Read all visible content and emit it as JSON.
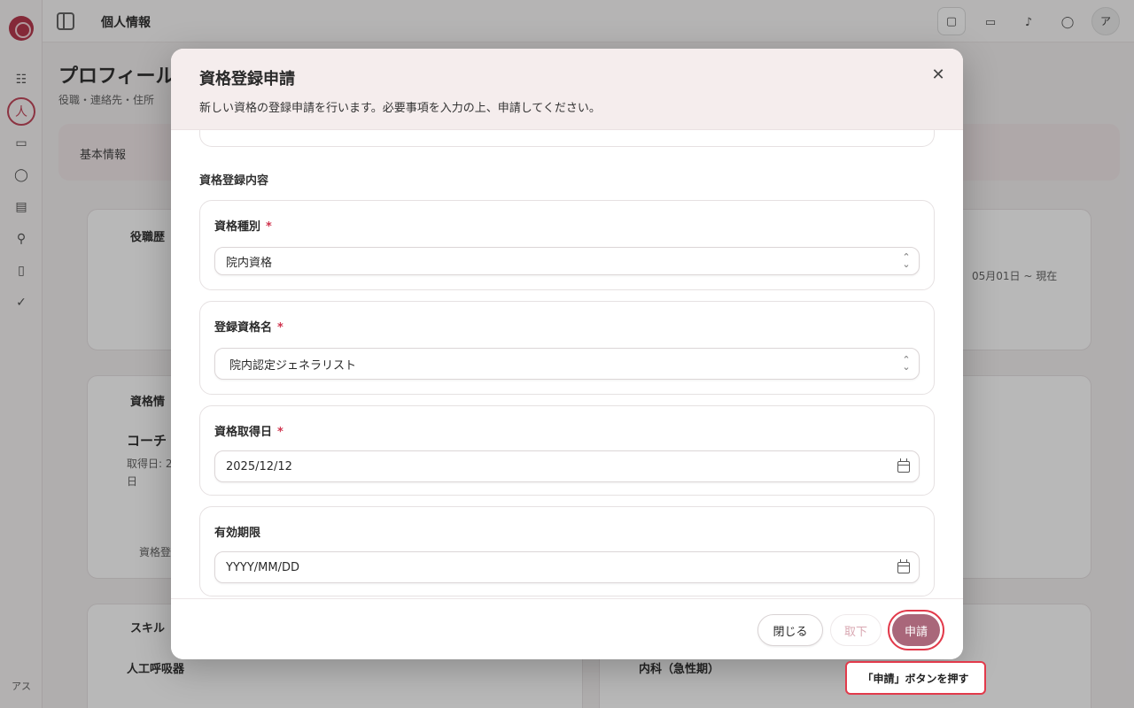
{
  "app": {
    "topbar_title": "個人情報",
    "avatar_initial": "ア",
    "sidebar_user": "アス"
  },
  "page": {
    "title": "プロフィール",
    "subtitle": "役職・連絡先・住所",
    "tab_basic": "基本情報",
    "bg_card_1_label": "役職歴",
    "bg_card_1_period": "05月01日 ~ 現在",
    "bg_card_2_label": "資格情",
    "bg_card_2_item": "コーチ",
    "bg_card_2_detail": "取得日: 2",
    "bg_card_2_detail2": "日",
    "bg_card_3_item": "資格登",
    "bg_card_4_label": "スキル",
    "bg_card_4_item": "人工呼吸器",
    "bg_card_5_item": "内科（急性期）"
  },
  "modal": {
    "title": "資格登録申請",
    "description": "新しい資格の登録申請を行います。必要事項を入力の上、申請してください。",
    "close_symbol": "✕",
    "section_title": "資格登録内容",
    "required_mark": "*",
    "fields": {
      "qualification_type": {
        "label": "資格種別",
        "value": "院内資格"
      },
      "qualification_name": {
        "label": "登録資格名",
        "value": "院内認定ジェネラリスト"
      },
      "acquired_date": {
        "label": "資格取得日",
        "value": "2025/12/12"
      },
      "expiry": {
        "label": "有効期限",
        "placeholder": "YYYY/MM/DD"
      }
    },
    "buttons": {
      "close": "閉じる",
      "withdraw": "取下",
      "apply": "申請"
    }
  },
  "tooltip": {
    "text": "「申請」ボタンを押す"
  },
  "colors": {
    "accent": "#a9677a",
    "highlight": "#e23a4b",
    "required": "#d0344e",
    "header_bg": "#f5eded"
  }
}
